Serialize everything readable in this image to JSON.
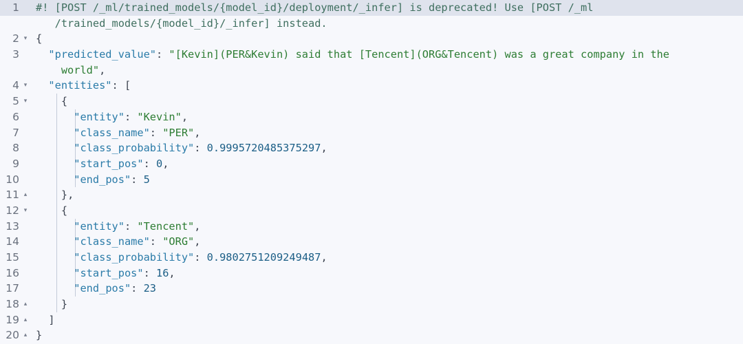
{
  "editor": {
    "kind": "json-response-viewer",
    "colors": {
      "background": "#f7f8fc",
      "highlight_row": "#dfe3ed",
      "line_number": "#69707d",
      "comment": "#3f6f5f",
      "key": "#2a7ba8",
      "string": "#2d7d33",
      "number": "#1b5e86",
      "punctuation": "#3c4350",
      "indent_guide": "#c3cad8"
    },
    "fold_open_icon": "▾",
    "fold_close_icon": "▴",
    "rows": [
      {
        "line": "1",
        "fold": "",
        "highlight": true,
        "indent_guides": 0,
        "tokens": [
          {
            "t": "cmt",
            "v": "#! [POST /_ml/trained_models/{model_id}/deployment/_infer] is deprecated! Use [POST /_ml"
          }
        ]
      },
      {
        "line": "",
        "fold": "",
        "highlight": false,
        "indent_guides": 0,
        "tokens": [
          {
            "t": "cmt",
            "v": "   /trained_models/{model_id}/_infer] instead."
          }
        ]
      },
      {
        "line": "2",
        "fold": "▾",
        "highlight": false,
        "indent_guides": 0,
        "tokens": [
          {
            "t": "brc",
            "v": "{"
          }
        ]
      },
      {
        "line": "3",
        "fold": "",
        "highlight": false,
        "indent_guides": 0,
        "tokens": [
          {
            "t": "pun",
            "v": "  "
          },
          {
            "t": "key",
            "v": "\"predicted_value\""
          },
          {
            "t": "pun",
            "v": ": "
          },
          {
            "t": "str",
            "v": "\"[Kevin](PER&Kevin) said that [Tencent](ORG&Tencent) was a great company in the"
          }
        ]
      },
      {
        "line": "",
        "fold": "",
        "highlight": false,
        "indent_guides": 0,
        "tokens": [
          {
            "t": "str",
            "v": "    world\""
          },
          {
            "t": "pun",
            "v": ","
          }
        ]
      },
      {
        "line": "4",
        "fold": "▾",
        "highlight": false,
        "indent_guides": 0,
        "tokens": [
          {
            "t": "pun",
            "v": "  "
          },
          {
            "t": "key",
            "v": "\"entities\""
          },
          {
            "t": "pun",
            "v": ": "
          },
          {
            "t": "brc",
            "v": "["
          }
        ]
      },
      {
        "line": "5",
        "fold": "▾",
        "highlight": false,
        "indent_guides": 1,
        "tokens": [
          {
            "t": "pun",
            "v": "    "
          },
          {
            "t": "brc",
            "v": "{"
          }
        ]
      },
      {
        "line": "6",
        "fold": "",
        "highlight": false,
        "indent_guides": 2,
        "tokens": [
          {
            "t": "pun",
            "v": "      "
          },
          {
            "t": "key",
            "v": "\"entity\""
          },
          {
            "t": "pun",
            "v": ": "
          },
          {
            "t": "str",
            "v": "\"Kevin\""
          },
          {
            "t": "pun",
            "v": ","
          }
        ]
      },
      {
        "line": "7",
        "fold": "",
        "highlight": false,
        "indent_guides": 2,
        "tokens": [
          {
            "t": "pun",
            "v": "      "
          },
          {
            "t": "key",
            "v": "\"class_name\""
          },
          {
            "t": "pun",
            "v": ": "
          },
          {
            "t": "str",
            "v": "\"PER\""
          },
          {
            "t": "pun",
            "v": ","
          }
        ]
      },
      {
        "line": "8",
        "fold": "",
        "highlight": false,
        "indent_guides": 2,
        "tokens": [
          {
            "t": "pun",
            "v": "      "
          },
          {
            "t": "key",
            "v": "\"class_probability\""
          },
          {
            "t": "pun",
            "v": ": "
          },
          {
            "t": "num",
            "v": "0.9995720485375297"
          },
          {
            "t": "pun",
            "v": ","
          }
        ]
      },
      {
        "line": "9",
        "fold": "",
        "highlight": false,
        "indent_guides": 2,
        "tokens": [
          {
            "t": "pun",
            "v": "      "
          },
          {
            "t": "key",
            "v": "\"start_pos\""
          },
          {
            "t": "pun",
            "v": ": "
          },
          {
            "t": "num",
            "v": "0"
          },
          {
            "t": "pun",
            "v": ","
          }
        ]
      },
      {
        "line": "10",
        "fold": "",
        "highlight": false,
        "indent_guides": 2,
        "tokens": [
          {
            "t": "pun",
            "v": "      "
          },
          {
            "t": "key",
            "v": "\"end_pos\""
          },
          {
            "t": "pun",
            "v": ": "
          },
          {
            "t": "num",
            "v": "5"
          }
        ]
      },
      {
        "line": "11",
        "fold": "▴",
        "highlight": false,
        "indent_guides": 1,
        "tokens": [
          {
            "t": "pun",
            "v": "    "
          },
          {
            "t": "brc",
            "v": "}"
          },
          {
            "t": "pun",
            "v": ","
          }
        ]
      },
      {
        "line": "12",
        "fold": "▾",
        "highlight": false,
        "indent_guides": 1,
        "tokens": [
          {
            "t": "pun",
            "v": "    "
          },
          {
            "t": "brc",
            "v": "{"
          }
        ]
      },
      {
        "line": "13",
        "fold": "",
        "highlight": false,
        "indent_guides": 2,
        "tokens": [
          {
            "t": "pun",
            "v": "      "
          },
          {
            "t": "key",
            "v": "\"entity\""
          },
          {
            "t": "pun",
            "v": ": "
          },
          {
            "t": "str",
            "v": "\"Tencent\""
          },
          {
            "t": "pun",
            "v": ","
          }
        ]
      },
      {
        "line": "14",
        "fold": "",
        "highlight": false,
        "indent_guides": 2,
        "tokens": [
          {
            "t": "pun",
            "v": "      "
          },
          {
            "t": "key",
            "v": "\"class_name\""
          },
          {
            "t": "pun",
            "v": ": "
          },
          {
            "t": "str",
            "v": "\"ORG\""
          },
          {
            "t": "pun",
            "v": ","
          }
        ]
      },
      {
        "line": "15",
        "fold": "",
        "highlight": false,
        "indent_guides": 2,
        "tokens": [
          {
            "t": "pun",
            "v": "      "
          },
          {
            "t": "key",
            "v": "\"class_probability\""
          },
          {
            "t": "pun",
            "v": ": "
          },
          {
            "t": "num",
            "v": "0.9802751209249487"
          },
          {
            "t": "pun",
            "v": ","
          }
        ]
      },
      {
        "line": "16",
        "fold": "",
        "highlight": false,
        "indent_guides": 2,
        "tokens": [
          {
            "t": "pun",
            "v": "      "
          },
          {
            "t": "key",
            "v": "\"start_pos\""
          },
          {
            "t": "pun",
            "v": ": "
          },
          {
            "t": "num",
            "v": "16"
          },
          {
            "t": "pun",
            "v": ","
          }
        ]
      },
      {
        "line": "17",
        "fold": "",
        "highlight": false,
        "indent_guides": 2,
        "tokens": [
          {
            "t": "pun",
            "v": "      "
          },
          {
            "t": "key",
            "v": "\"end_pos\""
          },
          {
            "t": "pun",
            "v": ": "
          },
          {
            "t": "num",
            "v": "23"
          }
        ]
      },
      {
        "line": "18",
        "fold": "▴",
        "highlight": false,
        "indent_guides": 1,
        "tokens": [
          {
            "t": "pun",
            "v": "    "
          },
          {
            "t": "brc",
            "v": "}"
          }
        ]
      },
      {
        "line": "19",
        "fold": "▴",
        "highlight": false,
        "indent_guides": 0,
        "tokens": [
          {
            "t": "pun",
            "v": "  "
          },
          {
            "t": "brc",
            "v": "]"
          }
        ]
      },
      {
        "line": "20",
        "fold": "▴",
        "highlight": false,
        "indent_guides": 0,
        "tokens": [
          {
            "t": "brc",
            "v": "}"
          }
        ]
      }
    ]
  }
}
